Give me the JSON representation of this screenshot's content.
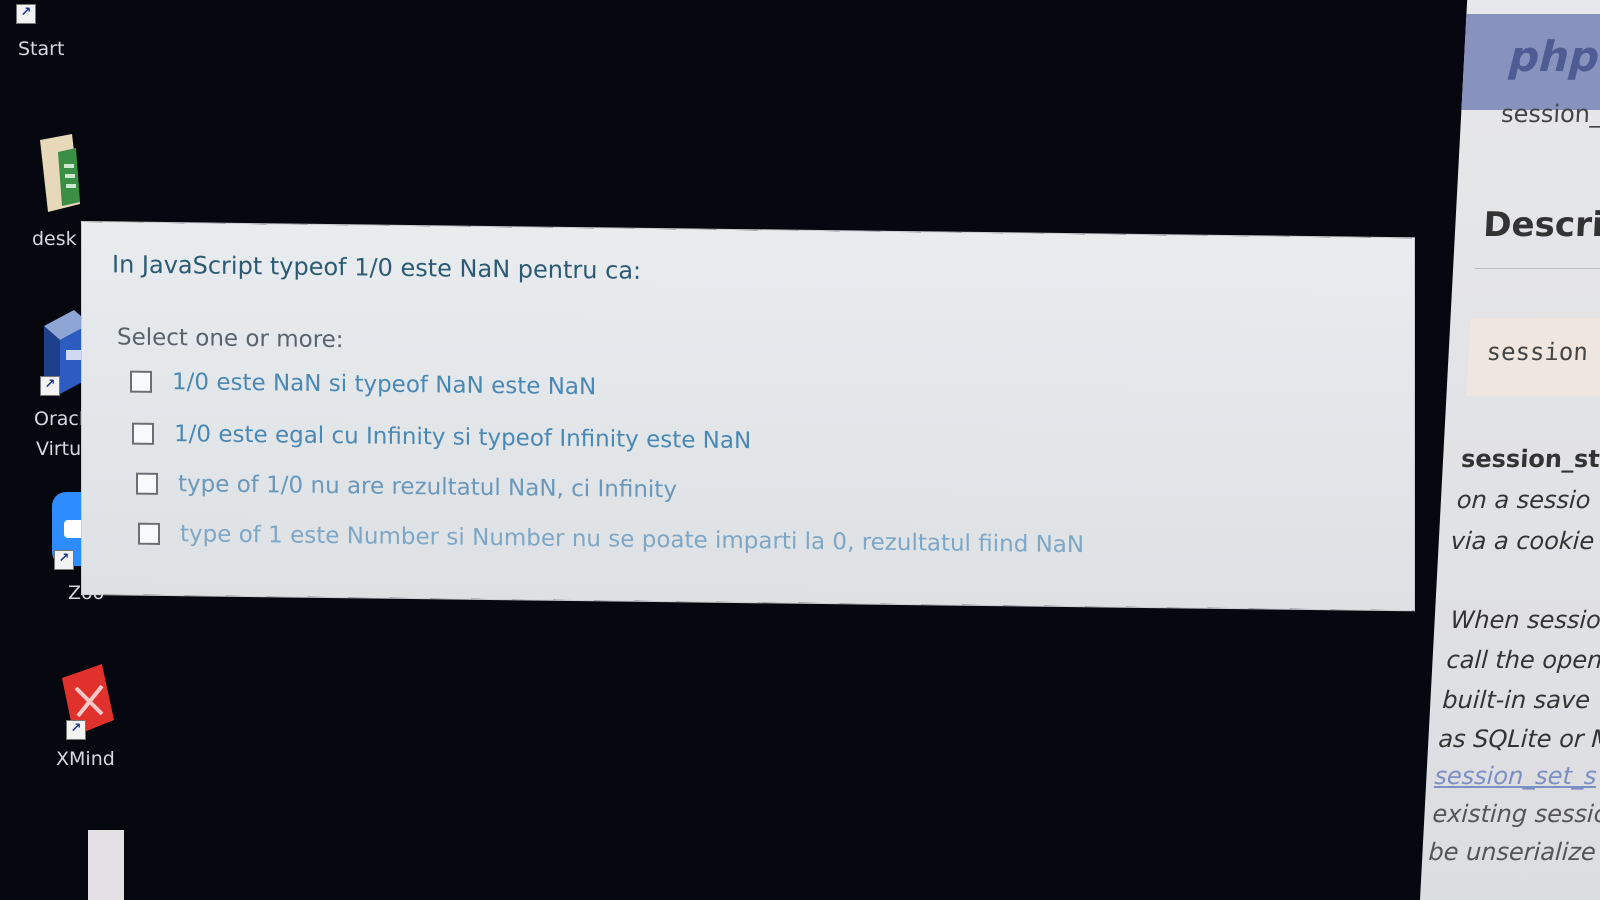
{
  "desktop": {
    "icons": [
      {
        "label": "Start"
      },
      {
        "label": "desk"
      },
      {
        "label_line1": "Oracle",
        "label_line2": "Virtua"
      },
      {
        "label": "Zoo"
      },
      {
        "label": "XMind"
      }
    ]
  },
  "quiz": {
    "question": "In JavaScript typeof 1/0 este NaN pentru ca:",
    "instruction": "Select one or more:",
    "options": [
      {
        "label": "1/0 este NaN si typeof NaN este NaN",
        "checked": false
      },
      {
        "label": "1/0 este egal cu Infinity si typeof Infinity este NaN",
        "checked": false
      },
      {
        "label": "type of 1/0 nu are rezultatul NaN, ci Infinity",
        "checked": false
      },
      {
        "label": "type of 1 este Number si Number nu se poate imparti la 0, rezultatul fiind NaN",
        "checked": false
      }
    ]
  },
  "php_panel": {
    "logo": "php",
    "breadcrumb": "session_",
    "heading": "Descrie",
    "code": "session",
    "function_name": "session_st",
    "lines": [
      "on a sessio",
      "via a cookie",
      "When sessio",
      "call the open",
      "built-in save",
      "as SQLite or M"
    ],
    "link": "session_set_s",
    "trailing_lines": [
      "existing sessio",
      "be unserialize"
    ],
    "colors": {
      "header": "#8892bf",
      "logo": "#4f5b93",
      "link": "#7c8fc5"
    }
  }
}
